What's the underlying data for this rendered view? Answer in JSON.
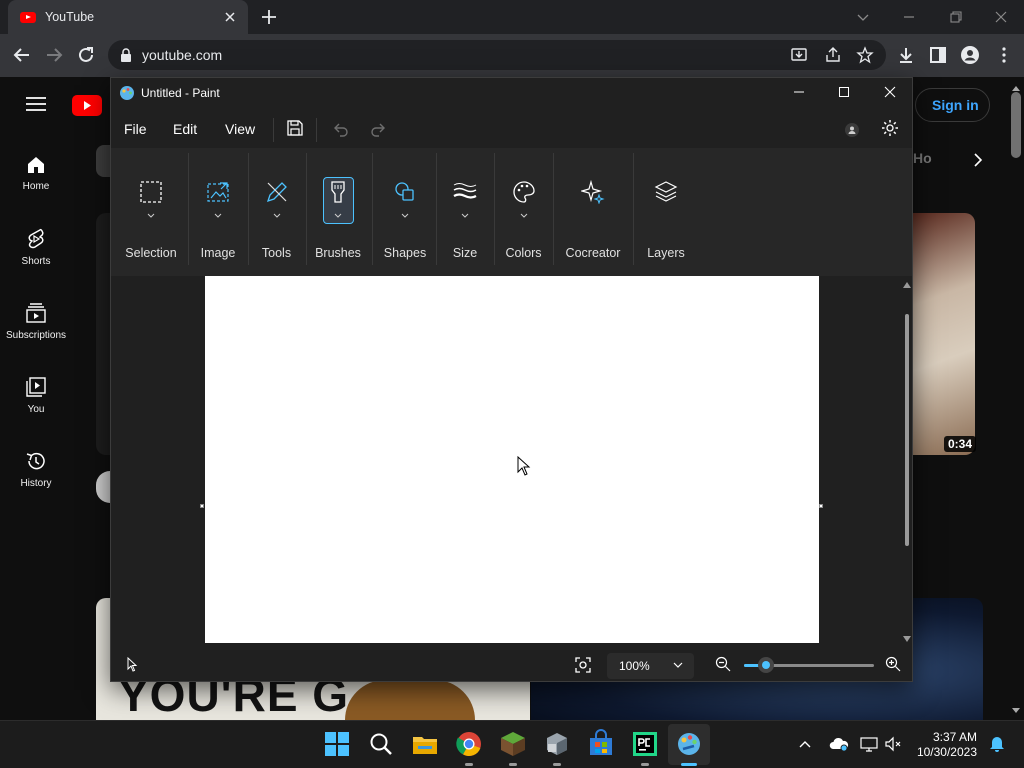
{
  "browser": {
    "tab_title": "YouTube",
    "url": "youtube.com"
  },
  "youtube": {
    "nav": [
      {
        "label": "Home"
      },
      {
        "label": "Shorts"
      },
      {
        "label": "Subscriptions"
      },
      {
        "label": "You"
      },
      {
        "label": "History"
      }
    ],
    "sign_in": "Sign in",
    "chip_partial": "Ho",
    "video_duration": "0:34",
    "thumbnail_text": "YOU'RE G"
  },
  "paint": {
    "window_title": "Untitled - Paint",
    "menus": [
      "File",
      "Edit",
      "View"
    ],
    "ribbon": [
      {
        "label": "Selection"
      },
      {
        "label": "Image"
      },
      {
        "label": "Tools"
      },
      {
        "label": "Brushes"
      },
      {
        "label": "Shapes"
      },
      {
        "label": "Size"
      },
      {
        "label": "Colors"
      },
      {
        "label": "Cocreator"
      },
      {
        "label": "Layers"
      }
    ],
    "zoom_level": "100%",
    "zoom_slider_fraction": 0.17
  },
  "taskbar": {
    "time": "3:37 AM",
    "date": "10/30/2023"
  },
  "colors": {
    "accent": "#4cc2ff",
    "youtube_red": "#ff0000",
    "link_blue": "#3ea6ff"
  }
}
